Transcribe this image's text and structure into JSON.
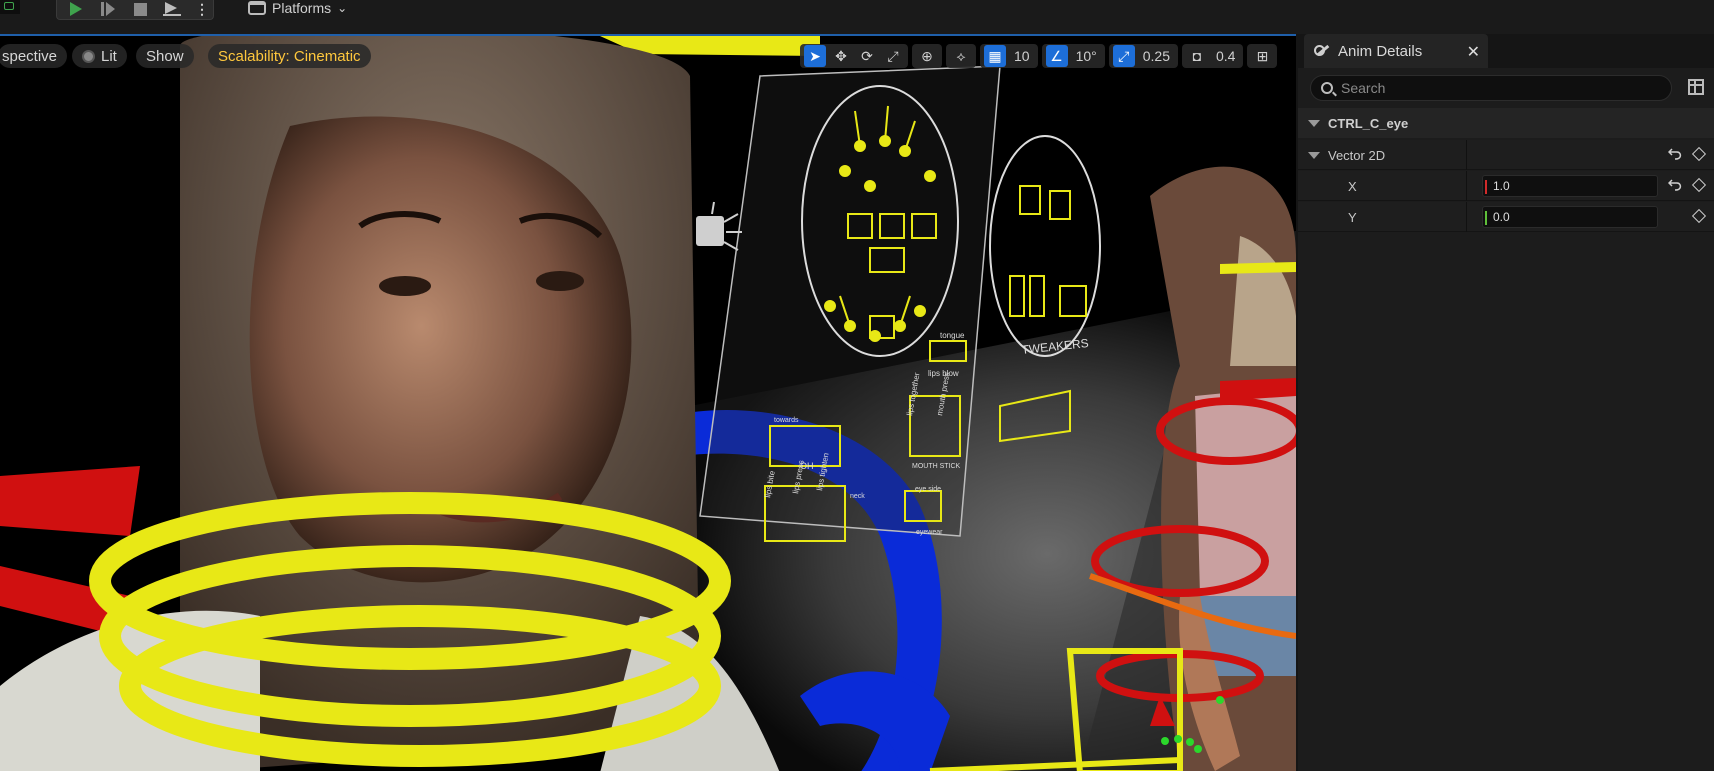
{
  "toolbar": {
    "platforms_label": "Platforms",
    "play_icon": "play-icon",
    "skip_icon": "skip-frame-icon",
    "stop_icon": "stop-icon",
    "eject_icon": "eject-icon",
    "kebab": "⋮",
    "chevron": "⌄"
  },
  "viewport": {
    "perspective_label": "spective",
    "lit_label": "Lit",
    "show_label": "Show",
    "scalability_label": "Scalability: Cinematic",
    "grid_value": "10",
    "angle_value": "10°",
    "scale_value": "0.25",
    "camera_speed_value": "0.4"
  },
  "scene_text": {
    "tweakers": "TWEAKERS",
    "tongue": "tongue",
    "lips_blow": "lips blow",
    "lips_together": "lips together",
    "mouth_press": "mouth press",
    "mouth_stick": "MOUTH STICK",
    "oh": "OH",
    "lips_bite": "lips bite",
    "lips_press": "lips press",
    "lips_tighten": "lips tighten",
    "neck": "neck",
    "eye_side": "eye side",
    "eyewear": "eyewear",
    "look_left": "towards"
  },
  "panel": {
    "tab_title": "Anim Details",
    "close": "✕",
    "search_placeholder": "Search",
    "section_title": "CTRL_C_eye",
    "group_label": "Vector 2D",
    "x_label": "X",
    "x_value": "1.0",
    "y_label": "Y",
    "y_value": "0.0",
    "x_axis_color": "#d12a2a",
    "y_axis_color": "#5fbf3a"
  },
  "colors": {
    "accent": "#1d6ed8",
    "scalability": "#ffc83d",
    "play_green": "#3fa34d",
    "gizmo_yellow": "#e8e816",
    "gizmo_blue": "#0a2bd8",
    "gizmo_red": "#d01010"
  }
}
